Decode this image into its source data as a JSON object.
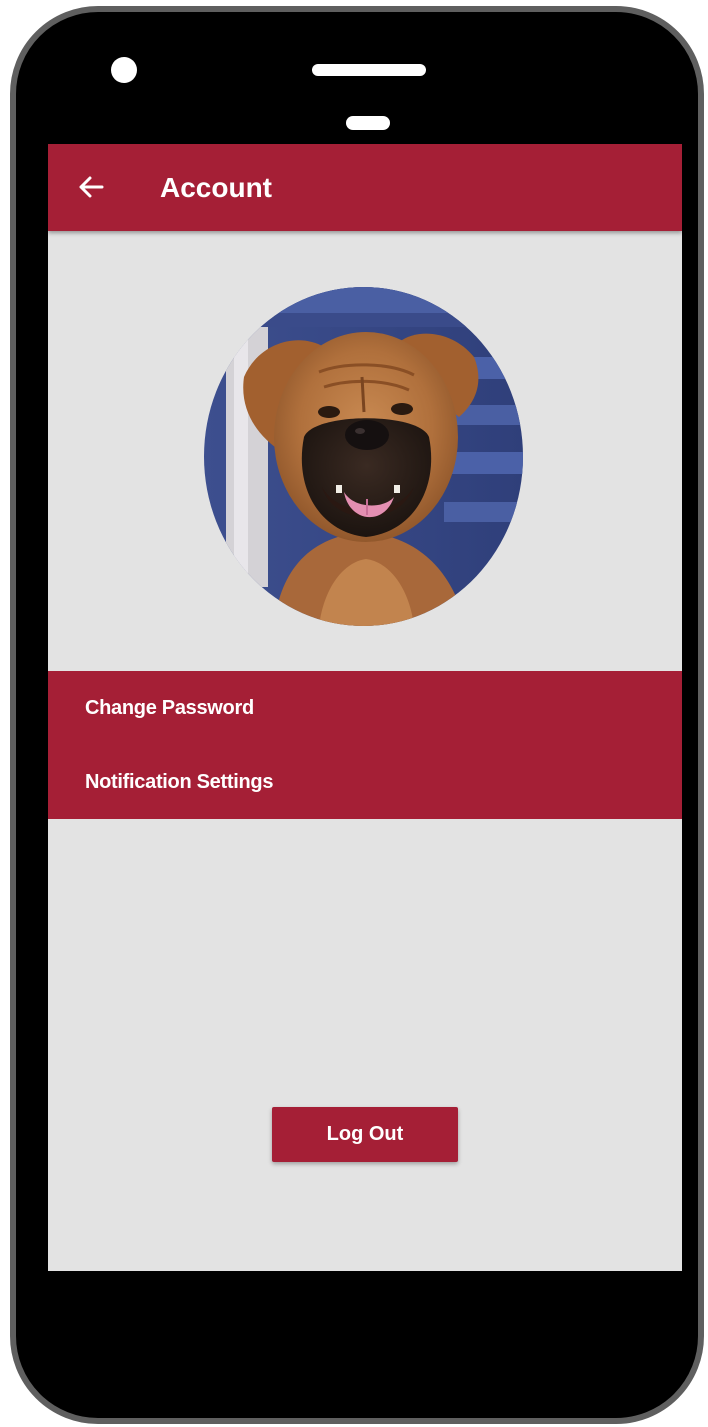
{
  "device": {
    "frame_color": "#5f5f5f",
    "body_color": "#000000"
  },
  "appbar": {
    "title": "Account",
    "back_icon": "arrow-left-icon",
    "background": "#a51f36"
  },
  "profile": {
    "avatar_description": "dog-photo"
  },
  "menu": {
    "items": [
      {
        "label": "Change Password"
      },
      {
        "label": "Notification Settings"
      }
    ],
    "background": "#a51f36"
  },
  "actions": {
    "logout_label": "Log Out"
  },
  "colors": {
    "accent": "#a51f36",
    "screen_background": "#e3e3e3",
    "text_on_accent": "#ffffff"
  }
}
